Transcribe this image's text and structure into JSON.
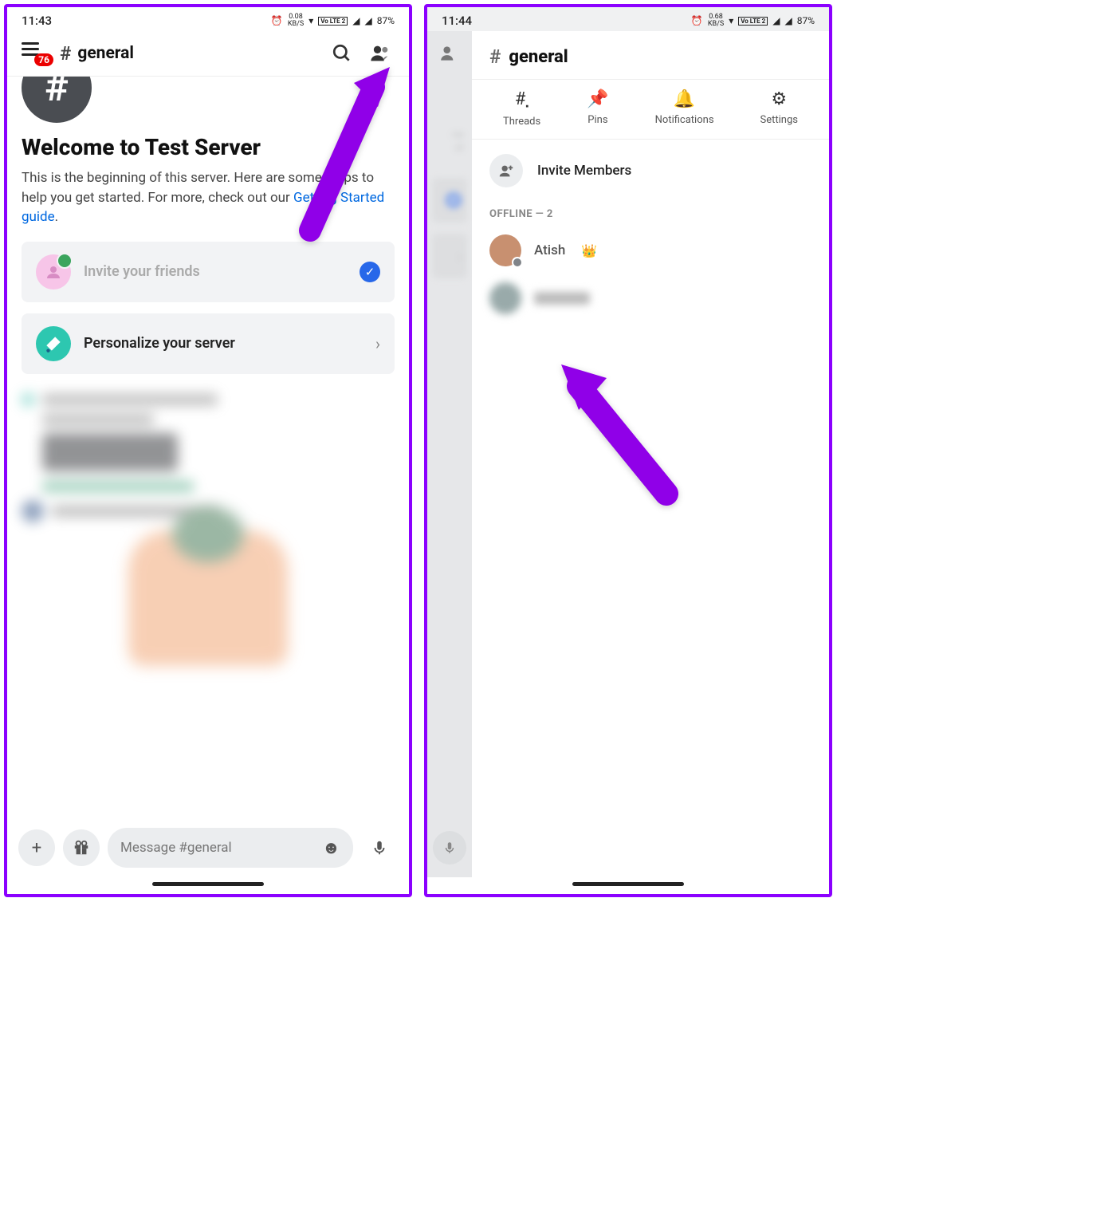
{
  "left": {
    "status": {
      "time": "11:43",
      "kbs": "0.08",
      "kbs_unit": "KB/S",
      "lte": "Vo LTE 2",
      "battery": "87%"
    },
    "header": {
      "badge": "76",
      "hash": "#",
      "channel": "general"
    },
    "welcome": {
      "hash": "#",
      "title": "Welcome to Test Server",
      "text_a": "This is the beginning of this server. Here are some steps to help you get started. For more, check out our ",
      "link": "Getting Started guide",
      "text_b": "."
    },
    "cards": {
      "invite": "Invite your friends",
      "personalize": "Personalize your server"
    },
    "input": {
      "placeholder": "Message #general"
    }
  },
  "right": {
    "status": {
      "time": "11:44",
      "kbs": "0.68",
      "kbs_unit": "KB/S",
      "lte": "Vo LTE 2",
      "battery": "87%"
    },
    "sliver": {
      "text_a": "ne",
      "text_b": "ut"
    },
    "panel": {
      "hash": "#",
      "title": "general",
      "tabs": {
        "threads": "Threads",
        "pins": "Pins",
        "notifications": "Notifications",
        "settings": "Settings"
      },
      "invite": "Invite Members",
      "section": "OFFLINE — 2",
      "members": [
        {
          "name": "Atish"
        },
        {
          "name": "hidden"
        }
      ]
    }
  }
}
